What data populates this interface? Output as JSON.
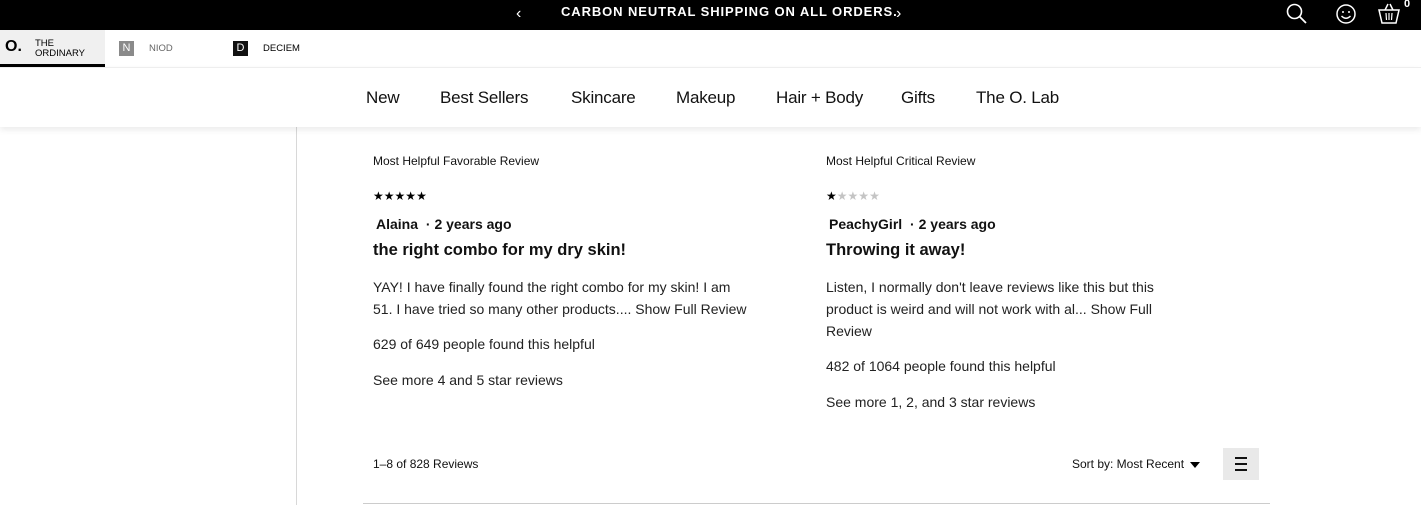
{
  "announcement": {
    "prev": "‹",
    "message": "CARBON NEUTRAL SHIPPING ON ALL ORDERS.",
    "next": "›",
    "cart_count": "0",
    "icons": [
      "search-icon",
      "account-icon",
      "cart-icon"
    ]
  },
  "brands": [
    {
      "logo": "O.",
      "name_line1": "THE",
      "name_line2": "ORDINARY",
      "active": true
    },
    {
      "logo": "N",
      "name": "NIOD"
    },
    {
      "logo": "D",
      "name": "DECIEM"
    }
  ],
  "nav": [
    "New",
    "Best Sellers",
    "Skincare",
    "Makeup",
    "Hair + Body",
    "Gifts",
    "The O. Lab"
  ],
  "reviews": {
    "favorable": {
      "label": "Most Helpful Favorable Review",
      "rating": 5,
      "author": "Alaina",
      "sep": "·",
      "age": "2 years ago",
      "title": "the right combo for my dry skin!",
      "body_line1": "YAY! I have finally found the right combo for my skin! I am",
      "body_line2": "51. I have tried so many other products....",
      "show_more": "Show Full Review",
      "helpful": "629 of 649 people found this helpful",
      "see_more": "See more 4 and 5 star reviews"
    },
    "critical": {
      "label": "Most Helpful Critical Review",
      "rating": 1,
      "author": "PeachyGirl",
      "sep": "·",
      "age": "2 years ago",
      "title": "Throwing it away!",
      "body_line1": "Listen, I normally don't leave reviews like this but this",
      "body_line2": "product is weird and will not work with al...",
      "show_more_1": "Show Full",
      "show_more_2": "Review",
      "helpful": "482 of 1064 people found this helpful",
      "see_more": "See more 1, 2, and 3 star reviews"
    }
  },
  "toolbar": {
    "count": "1–8 of 828 Reviews",
    "sort_label": "Sort by: Most Recent",
    "menu_icon": "menu-icon"
  },
  "colors": {
    "announcement_bg": "#000000",
    "active_brand_bg": "#f0f0f0",
    "star_off": "#c4c4c4"
  }
}
